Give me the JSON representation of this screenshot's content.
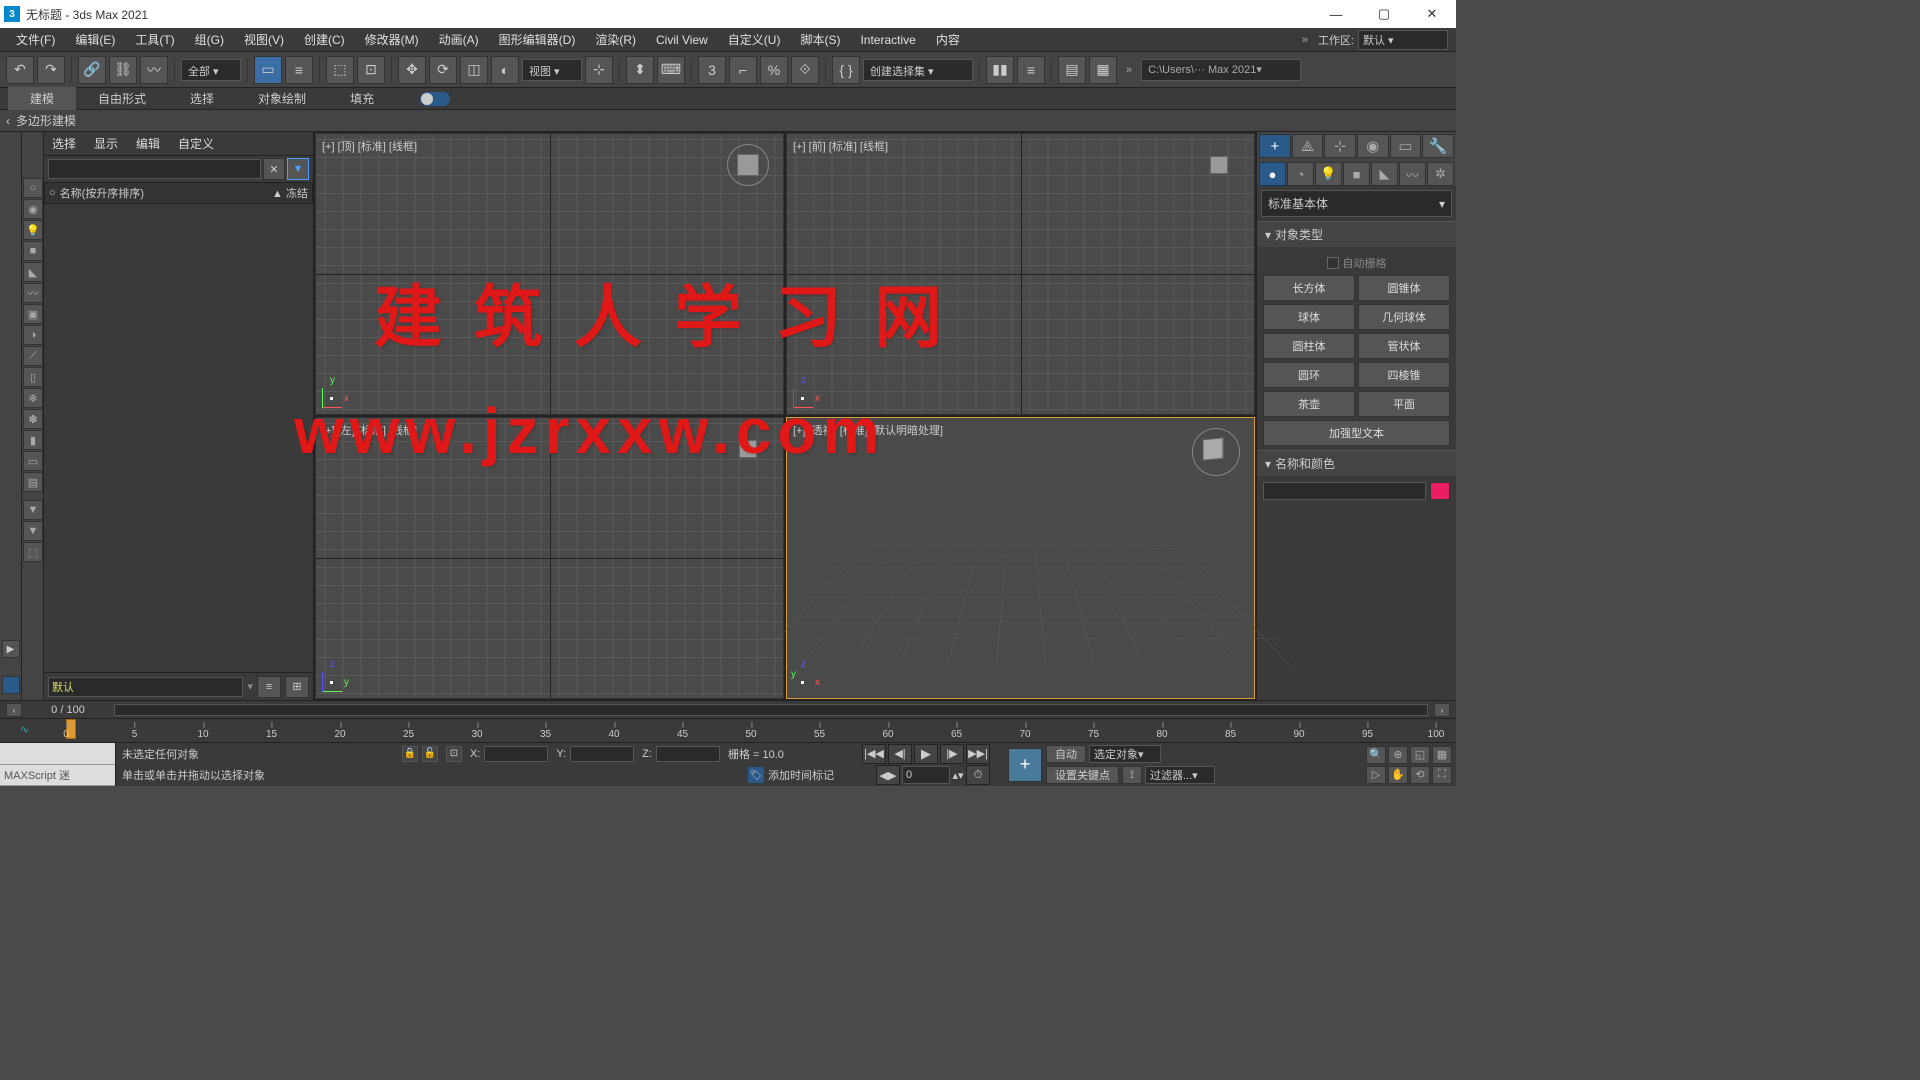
{
  "window": {
    "title": "无标题 - 3ds Max 2021",
    "icon_text": "3"
  },
  "menu": {
    "items": [
      "文件(F)",
      "编辑(E)",
      "工具(T)",
      "组(G)",
      "视图(V)",
      "创建(C)",
      "修改器(M)",
      "动画(A)",
      "图形编辑器(D)",
      "渲染(R)",
      "Civil View",
      "自定义(U)",
      "脚本(S)",
      "Interactive",
      "内容"
    ],
    "workspace_label": "工作区:",
    "workspace_value": "默认"
  },
  "toolbar": {
    "filter_all": "全部",
    "view_dropdown": "视图",
    "create_set": "创建选择集",
    "path": "C:\\Users\\··· Max 2021"
  },
  "tabs": {
    "items": [
      "建模",
      "自由形式",
      "选择",
      "对象绘制",
      "填充"
    ],
    "active": 0
  },
  "subheader": "多边形建模",
  "scene": {
    "tabs": [
      "选择",
      "显示",
      "编辑",
      "自定义"
    ],
    "name_header": "名称(按升序排序)",
    "freeze_header": "冻结",
    "default_text": "默认"
  },
  "viewports": {
    "top": "[+] [顶]  [标准]  [线框]",
    "front": "[+] [前]  [标准]  [线框]",
    "left": "[+] [左]  [标准]  [线框]",
    "persp": "[+] [透视]  [标准]  [默认明暗处理]"
  },
  "watermark": {
    "line1": "建筑人学习网",
    "line2": "www.jzrxxw.com"
  },
  "cmdpanel": {
    "category": "标准基本体",
    "rollout_objtype": "对象类型",
    "autogrid": "自动栅格",
    "objects": [
      "长方体",
      "圆锥体",
      "球体",
      "几何球体",
      "圆柱体",
      "管状体",
      "圆环",
      "四棱锥",
      "茶壶",
      "平面"
    ],
    "ext_text": "加强型文本",
    "rollout_namecolor": "名称和颜色"
  },
  "timeline": {
    "frame_display": "0 / 100",
    "ticks": [
      "0",
      "5",
      "10",
      "15",
      "20",
      "25",
      "30",
      "35",
      "40",
      "45",
      "50",
      "55",
      "60",
      "65",
      "70",
      "75",
      "80",
      "85",
      "90",
      "95",
      "100"
    ]
  },
  "status": {
    "maxscript": "MAXScript 迷",
    "no_selection": "未选定任何对象",
    "prompt": "单击或单击并拖动以选择对象",
    "x": "X:",
    "y": "Y:",
    "z": "Z:",
    "grid": "栅格 = 10.0",
    "addtime": "添加时间标记",
    "auto": "自动",
    "selected_obj": "选定对象",
    "set_key": "设置关键点",
    "filter": "过滤器...",
    "frame_value": "0"
  }
}
